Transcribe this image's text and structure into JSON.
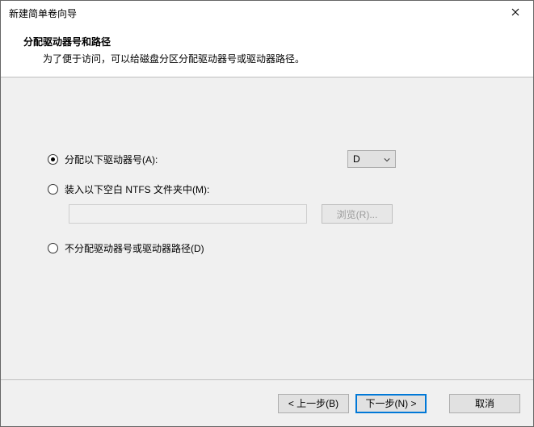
{
  "window": {
    "title": "新建简单卷向导"
  },
  "header": {
    "heading": "分配驱动器号和路径",
    "subheading": "为了便于访问，可以给磁盘分区分配驱动器号或驱动器路径。"
  },
  "options": {
    "assign": {
      "label": "分配以下驱动器号(A):",
      "checked": true,
      "drive_value": "D"
    },
    "mount": {
      "label": "装入以下空白 NTFS 文件夹中(M):",
      "checked": false,
      "path_value": "",
      "browse_label": "浏览(R)..."
    },
    "none": {
      "label": "不分配驱动器号或驱动器路径(D)",
      "checked": false
    }
  },
  "footer": {
    "back_label": "< 上一步(B)",
    "next_label": "下一步(N) >",
    "cancel_label": "取消"
  }
}
